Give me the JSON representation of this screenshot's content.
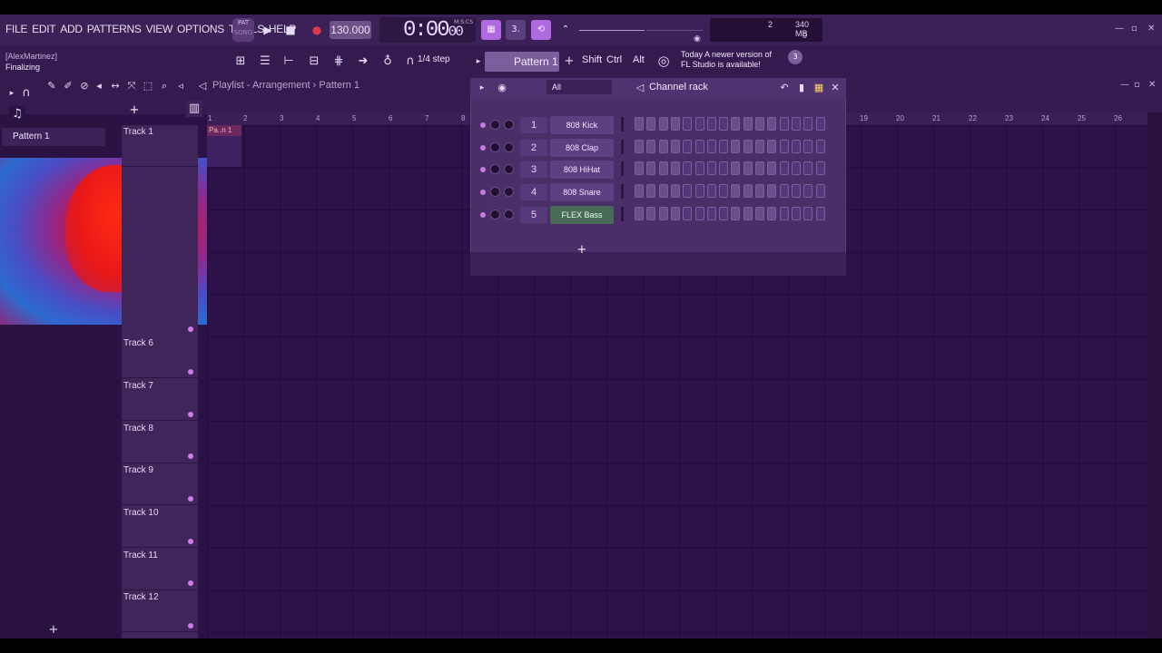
{
  "menu": [
    "FILE",
    "EDIT",
    "ADD",
    "PATTERNS",
    "VIEW",
    "OPTIONS",
    "TOOLS",
    "HELP"
  ],
  "transport": {
    "pat_label": "PAT",
    "song_label": "SONG",
    "tempo": "130.000",
    "time": "0:00",
    "time_small": "00",
    "mcs": "M:S:CS"
  },
  "cpu": {
    "value": "2",
    "memory": "340 MB",
    "polyphony": "0"
  },
  "hint": {
    "user": "[AlexMartinez]",
    "status": "Finalizing"
  },
  "toolbar2": {
    "step": "1/4 step",
    "pattern": "Pattern 1",
    "keys": [
      "Shift",
      "Ctrl",
      "Alt"
    ],
    "news_line1": "Today  A newer version of",
    "news_line2": "FL Studio is available!",
    "news_count": "3"
  },
  "browser": {
    "pattern_item": "Pattern 1"
  },
  "playlist": {
    "title": "Playlist - Arrangement",
    "breadcrumb": "Pattern 1",
    "ruler": [
      "1",
      "2",
      "3",
      "4",
      "5",
      "6",
      "7",
      "8",
      "19",
      "20",
      "21",
      "22",
      "23",
      "24",
      "25",
      "26"
    ],
    "clip_label": "Pa..n 1",
    "tracks": [
      "Track 1",
      "Track 6",
      "Track 7",
      "Track 8",
      "Track 9",
      "Track 10",
      "Track 11",
      "Track 12"
    ]
  },
  "channel_rack": {
    "title": "Channel rack",
    "filter": "All",
    "channels": [
      {
        "num": "1",
        "name": "808 Kick",
        "selected": false
      },
      {
        "num": "2",
        "name": "808 Clap",
        "selected": false
      },
      {
        "num": "3",
        "name": "808 HiHat",
        "selected": false
      },
      {
        "num": "4",
        "name": "808 Snare",
        "selected": false
      },
      {
        "num": "5",
        "name": "FLEX Bass",
        "selected": true
      }
    ]
  },
  "colors": {
    "background": "#2b1246",
    "accent": "#c57be0",
    "record": "#e0384a"
  }
}
